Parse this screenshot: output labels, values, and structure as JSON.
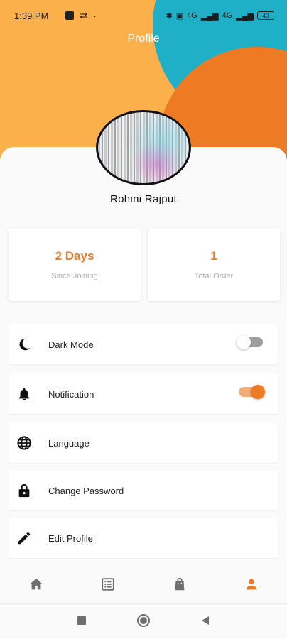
{
  "status_bar": {
    "time": "1:39 PM",
    "signal_label_1": "4G",
    "signal_label_2": "4G",
    "battery": "40"
  },
  "header": {
    "title": "Profile"
  },
  "profile": {
    "name": "Rohini Rajput"
  },
  "stats": [
    {
      "value": "2 Days",
      "label": "Since Joining"
    },
    {
      "value": "1",
      "label": "Total Order"
    }
  ],
  "settings": [
    {
      "label": "Dark Mode",
      "icon": "moon-icon",
      "toggle": false
    },
    {
      "label": "Notification",
      "icon": "bell-icon",
      "toggle": true
    },
    {
      "label": "Language",
      "icon": "globe-icon"
    },
    {
      "label": "Change Password",
      "icon": "lock-icon"
    },
    {
      "label": "Edit Profile",
      "icon": "pencil-icon"
    }
  ],
  "bottom_nav": [
    "home-icon",
    "list-icon",
    "bag-icon",
    "person-icon"
  ],
  "colors": {
    "accent": "#ef7a24",
    "hero_yellow": "#fbb04c",
    "hero_teal": "#1fb0c8",
    "stat_value": "#e87d2f"
  }
}
